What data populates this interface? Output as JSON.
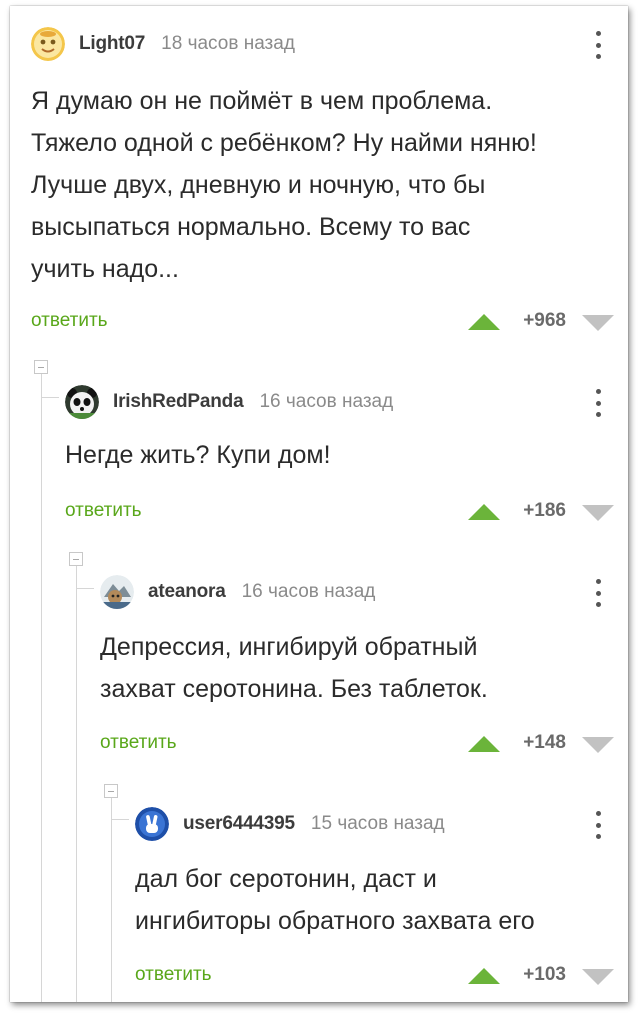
{
  "comments": [
    {
      "username": "Light07",
      "time": "18 часов назад",
      "avatar_icon": "yellow-face-avatar-icon",
      "text_lines": [
        "Я думаю он не поймёт в чем проблема.",
        "Тяжело одной с ребёнком? Ну найми няню!",
        "Лучше двух, дневную и ночную, что бы",
        "высыпаться нормально. Всему то вас",
        "учить надо..."
      ],
      "reply_label": "ответить",
      "rating": "+968"
    },
    {
      "username": "IrishRedPanda",
      "time": "16 часов назад",
      "avatar_icon": "panda-avatar-icon",
      "text_lines": [
        "Негде жить? Купи дом!"
      ],
      "reply_label": "ответить",
      "rating": "+186"
    },
    {
      "username": "ateanora",
      "time": "16 часов назад",
      "avatar_icon": "photo-avatar-icon",
      "text_lines": [
        "Депрессия, ингибируй обратный",
        "захват серотонина. Без таблеток."
      ],
      "reply_label": "ответить",
      "rating": "+148"
    },
    {
      "username": "user6444395",
      "time": "15 часов назад",
      "avatar_icon": "peace-hand-avatar-icon",
      "text_lines": [
        "дал бог серотонин, даст и",
        "ингибиторы обратного захвата его"
      ],
      "reply_label": "ответить",
      "rating": "+103"
    }
  ],
  "colors": {
    "reply_green": "#59a71a",
    "upvote_green": "#6bb43a",
    "downvote_gray": "#c2c2c2"
  }
}
